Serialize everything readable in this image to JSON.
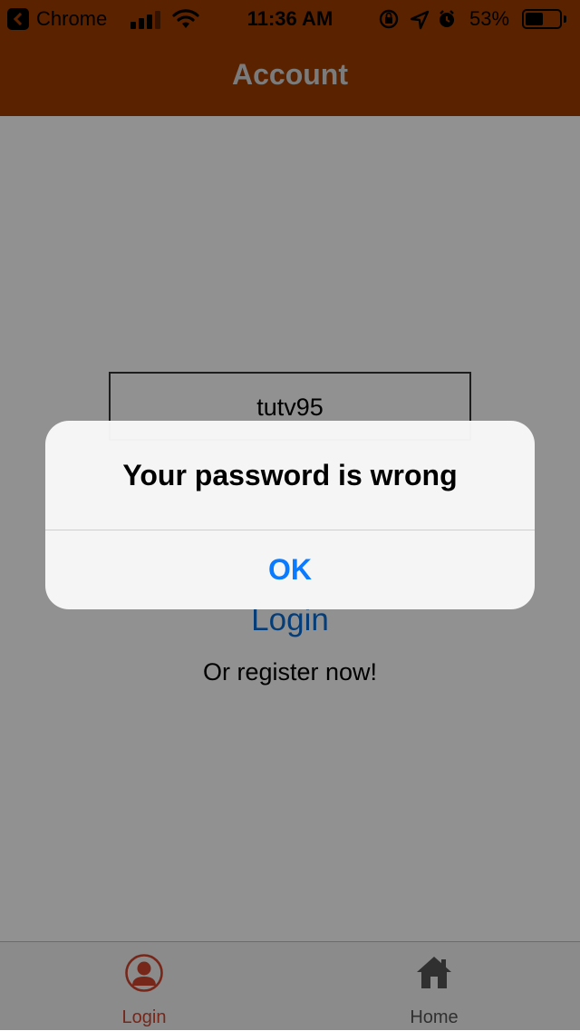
{
  "status_bar": {
    "back_app": "Chrome",
    "time": "11:36 AM",
    "battery_percent": "53%",
    "battery_level": 0.53,
    "icons": [
      "back-icon",
      "signal-icon",
      "wifi-icon",
      "rotation-lock-icon",
      "location-icon",
      "alarm-icon",
      "battery-icon"
    ]
  },
  "header": {
    "title": "Account"
  },
  "form": {
    "username_value": "tutv95",
    "login_label": "Login",
    "register_label": "Or register now!"
  },
  "alert": {
    "message": "Your password is wrong",
    "ok_label": "OK"
  },
  "tabbar": {
    "tabs": [
      {
        "label": "Login",
        "icon": "user-icon",
        "active": true
      },
      {
        "label": "Home",
        "icon": "home-icon",
        "active": false
      }
    ]
  },
  "colors": {
    "header_bg": "#a03c00",
    "accent_active_tab": "#d0452f",
    "link_blue": "#0a6cd4",
    "alert_button": "#0a7aff",
    "inactive_tab": "#555555"
  }
}
